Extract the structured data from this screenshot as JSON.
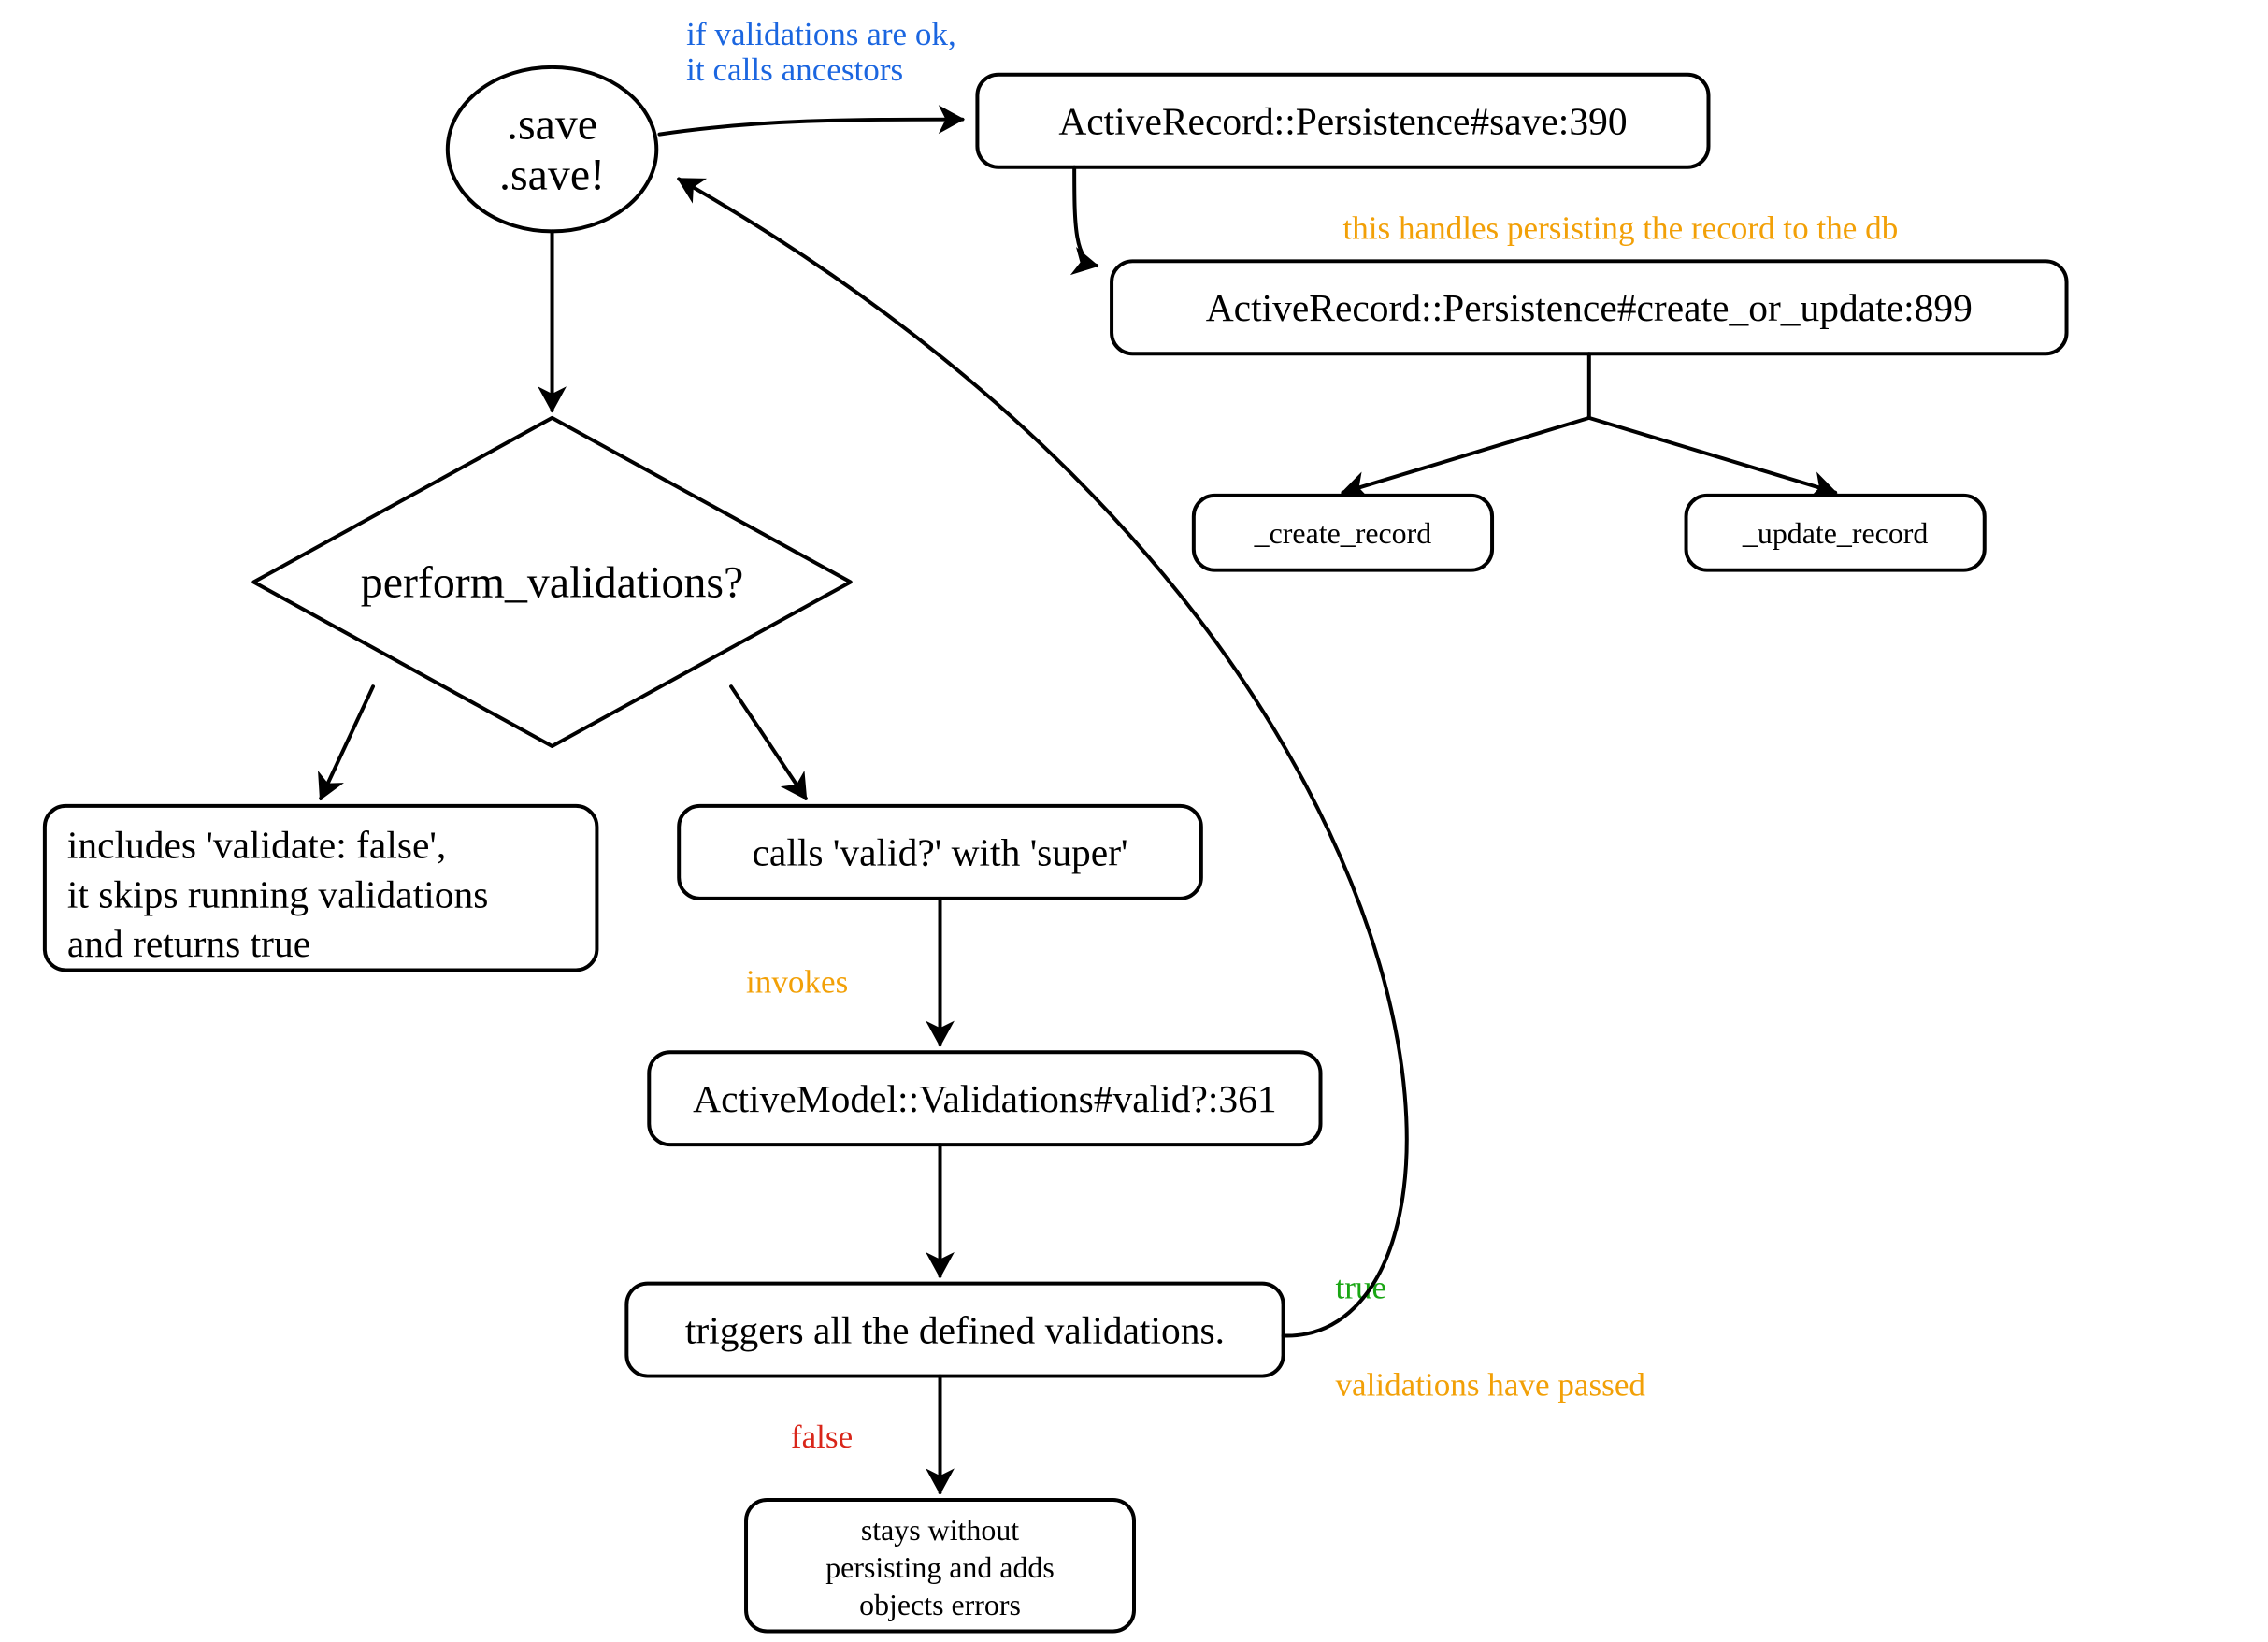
{
  "nodes": {
    "start_l1": ".save",
    "start_l2": ".save!",
    "decision": "perform_validations?",
    "skip_l1": "includes 'validate: false',",
    "skip_l2": "it skips running validations",
    "skip_l3": "and returns true",
    "calls_valid": "calls 'valid?' with 'super'",
    "am_valid": "ActiveModel::Validations#valid?:361",
    "triggers": "triggers all the defined validations.",
    "stays_l1": "stays without",
    "stays_l2": "persisting and adds",
    "stays_l3": "objects errors",
    "ar_save": "ActiveRecord::Persistence#save:390",
    "ar_cou": "ActiveRecord::Persistence#create_or_update:899",
    "create_record": "_create_record",
    "update_record": "_update_record"
  },
  "annotations": {
    "invokes": "invokes",
    "true": "true",
    "false": "false",
    "validations_passed": "validations have passed",
    "ancestors_l1": "if validations are ok,",
    "ancestors_l2": "it calls ancestors",
    "handles_db": "this handles persisting the record to the db"
  }
}
